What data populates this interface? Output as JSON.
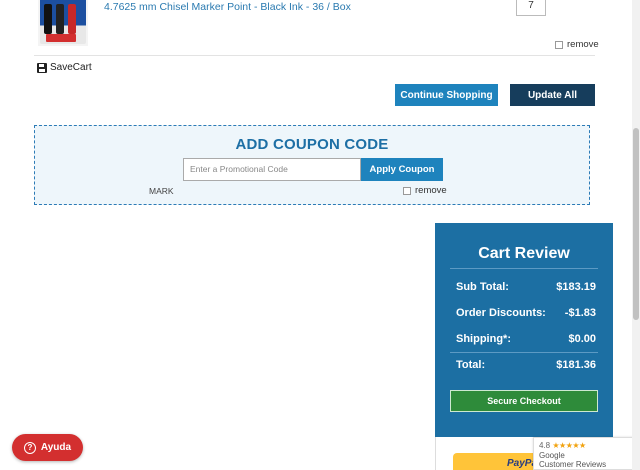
{
  "product": {
    "name": "4.7625 mm Chisel Marker Point - Black Ink - 36 / Box",
    "quantity": "7",
    "remove_label": "remove"
  },
  "cart_actions": {
    "save_cart_label": "SaveCart",
    "continue_label": "Continue Shopping",
    "update_label": "Update All"
  },
  "coupon": {
    "title": "ADD COUPON CODE",
    "input_placeholder": "Enter a Promotional Code",
    "apply_label": "Apply Coupon",
    "applied_code": "MARK",
    "remove_label": "remove"
  },
  "cart_review": {
    "title": "Cart Review",
    "rows": [
      {
        "label": "Sub Total:",
        "value": "$183.19"
      },
      {
        "label": "Order Discounts:",
        "value": "-$1.83"
      },
      {
        "label": "Shipping*:",
        "value": "$0.00"
      },
      {
        "label": "Total:",
        "value": "$181.36"
      }
    ],
    "checkout_label": "Secure Checkout",
    "paypal_label": "PayPal"
  },
  "google_badge": {
    "rating": "4.8",
    "stars": "★★★★★",
    "line1": "Google",
    "line2": "Customer Reviews"
  },
  "help": {
    "label": "Ayuda",
    "icon": "?"
  },
  "colors": {
    "primary_blue": "#1e83bd",
    "dark_navy": "#163d5c",
    "cart_panel": "#1c6fa3",
    "checkout_green": "#2e8b3a",
    "help_red": "#d32f2f"
  }
}
